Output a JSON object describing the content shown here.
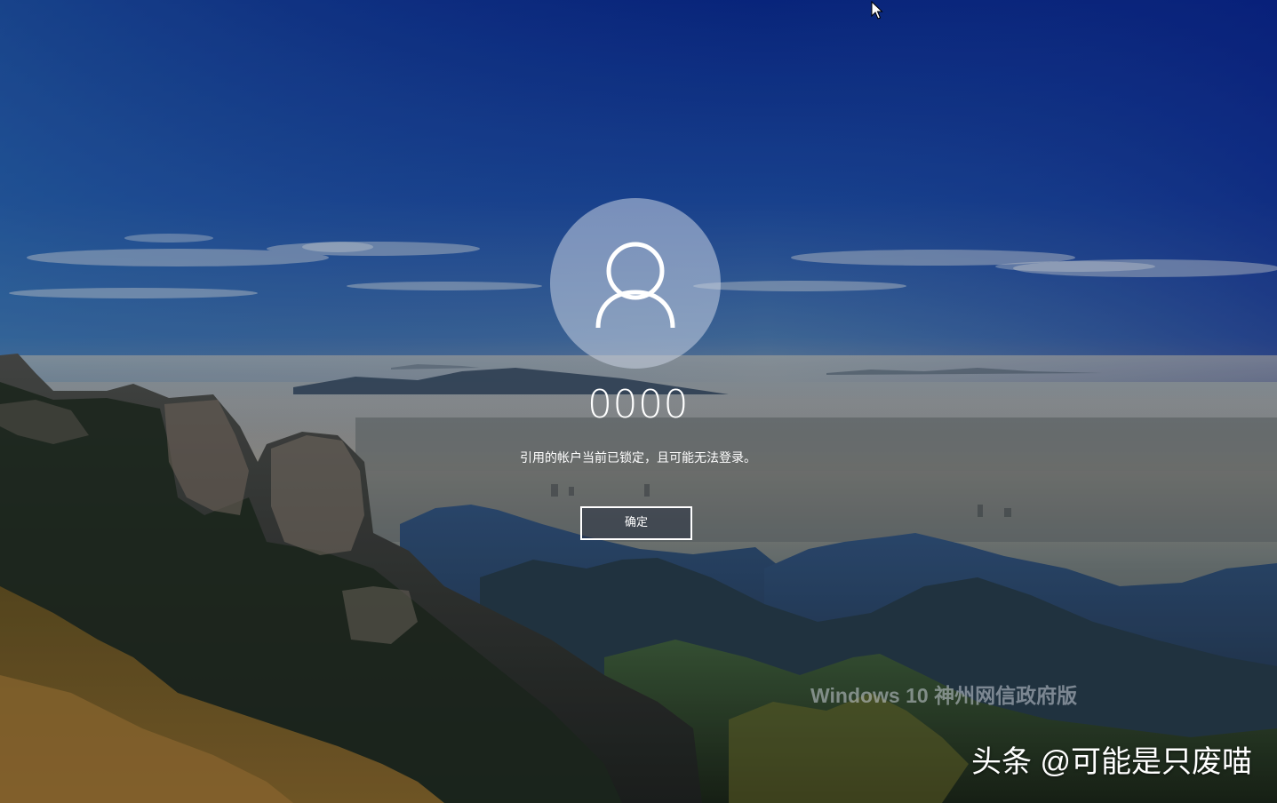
{
  "lock_screen": {
    "username": "0000",
    "message": "引用的帐户当前已锁定，且可能无法登录。",
    "ok_button_label": "确定",
    "user_icon": "user-silhouette-icon"
  },
  "watermark": {
    "text": "Windows 10 神州网信政府版"
  },
  "credit": {
    "text": "头条 @可能是只废喵"
  },
  "cursor": {
    "icon": "arrow-cursor-icon"
  },
  "colors": {
    "sky_top": "#0b2a8a",
    "sky_mid": "#2f5da8",
    "horizon": "#9a9a94",
    "mountain_dark": "#1b2a33",
    "foliage": "#8a6a2a",
    "text": "#ffffff"
  }
}
